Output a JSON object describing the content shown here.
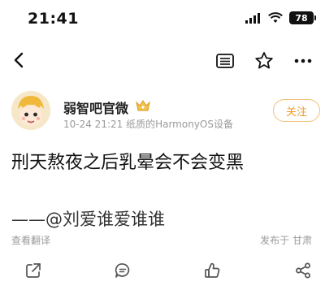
{
  "status_bar": {
    "time": "21:41",
    "battery_level": "78",
    "icons": [
      "signal-icon",
      "wifi-icon",
      "battery-icon"
    ]
  },
  "nav": {
    "icons": [
      "back-icon",
      "reader-icon",
      "star-icon",
      "more-icon"
    ]
  },
  "post": {
    "author_name": "弱智吧官微",
    "meta": "10-24 21:21  纸质的HarmonyOS设备",
    "follow_label": "关注",
    "text": "刑天熬夜之后乳晕会不会变黑",
    "signature": "——@刘爱谁爱谁谁",
    "translate_label": "查看翻译",
    "posted_from": "发布于 甘肃"
  },
  "actions": {
    "icons": [
      "share-icon",
      "comment-icon",
      "like-icon",
      "forward-icon"
    ]
  },
  "colors": {
    "accent": "#ee9a27",
    "muted_text": "#9a9a9a",
    "primary_text": "#111111"
  }
}
